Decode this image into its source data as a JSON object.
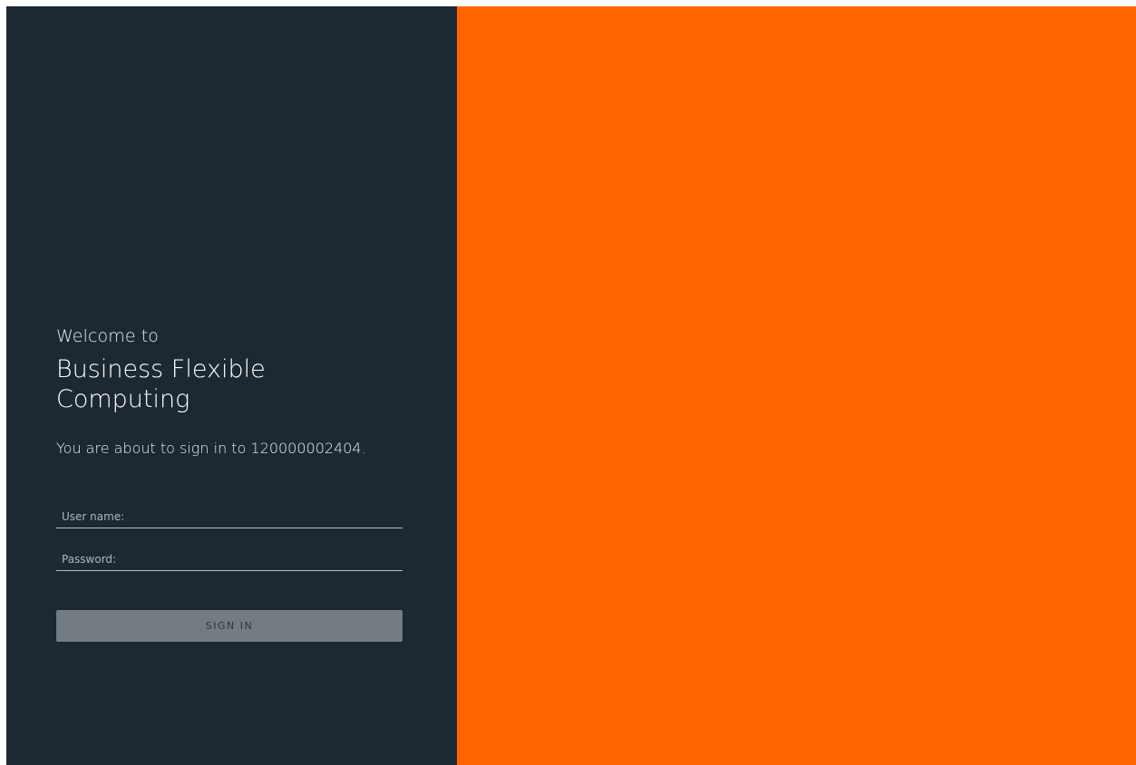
{
  "login": {
    "welcome": "Welcome to",
    "product_name": "Business Flexible Computing",
    "sign_in_note": "You are about to sign in to 120000002404.",
    "username_placeholder": "User name:",
    "password_placeholder": "Password:",
    "sign_in_label": "SIGN IN"
  },
  "colors": {
    "left_panel": "#1c2832",
    "right_panel": "#ff6600",
    "button_disabled": "#737c83"
  }
}
